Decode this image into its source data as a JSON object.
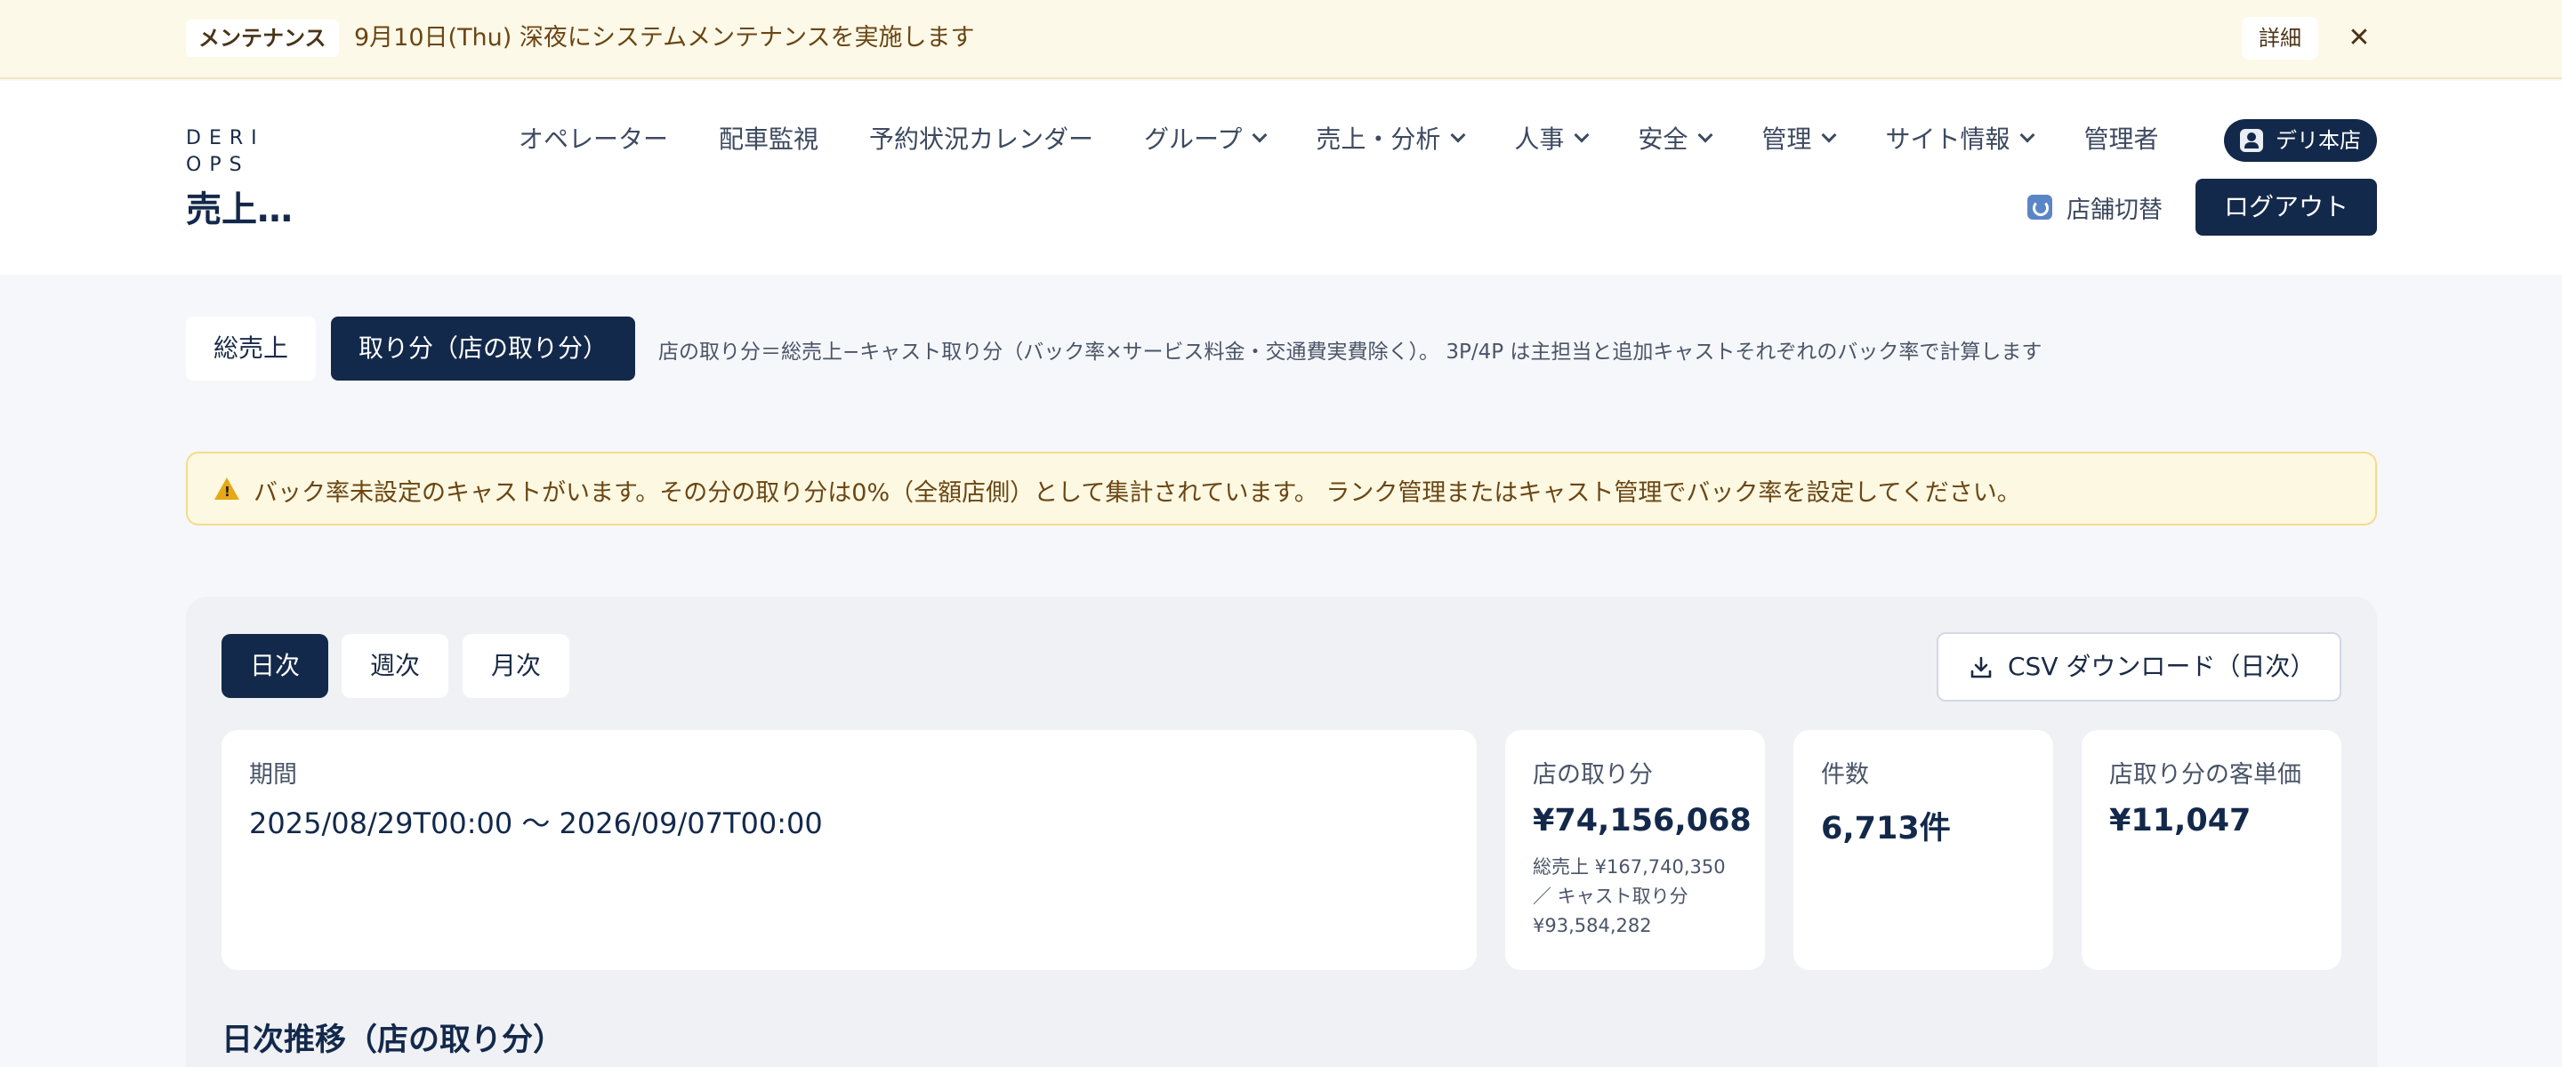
{
  "banner": {
    "badge": "メンテナンス",
    "message": "9月10日(Thu) 深夜にシステムメンテナンスを実施します",
    "detail_label": "詳細",
    "close_glyph": "✕"
  },
  "header": {
    "logo_line1": "DERI",
    "logo_line2": "OPS",
    "page_title": "売上…",
    "nav": [
      {
        "label": "オペレーター",
        "dropdown": false
      },
      {
        "label": "配車監視",
        "dropdown": false
      },
      {
        "label": "予約状況カレンダー",
        "dropdown": false
      },
      {
        "label": "グループ",
        "dropdown": true
      },
      {
        "label": "売上・分析",
        "dropdown": true
      },
      {
        "label": "人事",
        "dropdown": true
      },
      {
        "label": "安全",
        "dropdown": true
      },
      {
        "label": "管理",
        "dropdown": true
      },
      {
        "label": "サイト情報",
        "dropdown": true
      },
      {
        "label": "管理者",
        "dropdown": false
      }
    ],
    "store_pill": "デリ本店",
    "store_switch": "店舗切替",
    "logout": "ログアウト"
  },
  "mode": {
    "gross_label": "総売上",
    "share_label": "取り分（店の取り分）",
    "note": "店の取り分＝総売上−キャスト取り分（バック率×サービス料金・交通費実費除く）。 3P/4P は主担当と追加キャストそれぞれのバック率で計算します"
  },
  "warning": {
    "icon_glyph": "!",
    "text": "バック率未設定のキャストがいます。その分の取り分は0%（全額店側）として集計されています。 ランク管理またはキャスト管理でバック率を設定してください。"
  },
  "panel": {
    "tabs": [
      "日次",
      "週次",
      "月次"
    ],
    "csv_label": "CSV ダウンロード（日次）",
    "period_label": "期間",
    "period_value": "2025/08/29T00:00 〜 2026/09/07T00:00",
    "share_label": "店の取り分",
    "share_value": "¥74,156,068",
    "share_sub1": "総売上 ¥167,740,350",
    "share_sub2": "／ キャスト取り分",
    "share_sub3": "¥93,584,282",
    "count_label": "件数",
    "count_value": "6,713件",
    "unit_label": "店取り分の客単価",
    "unit_value": "¥11,047",
    "section_title": "日次推移（店の取り分）"
  },
  "colors": {
    "primary": "#13294b",
    "banner_bg": "#fdf9e8",
    "warning_bg": "#fdf8e2",
    "warning_border": "#f3dc8a",
    "warning_icon": "#e6a817"
  }
}
